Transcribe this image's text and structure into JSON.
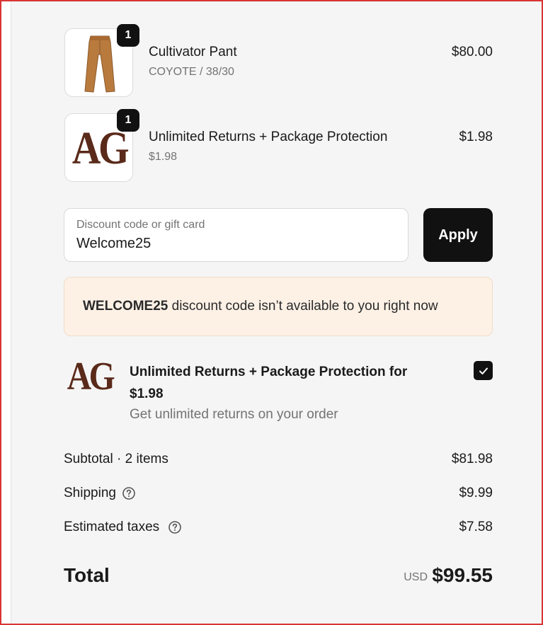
{
  "line_items": [
    {
      "quantity": "1",
      "name": "Cultivator Pant",
      "variant": "COYOTE / 38/30",
      "price": "$80.00",
      "image": "pants-image"
    },
    {
      "quantity": "1",
      "name": "Unlimited Returns + Package Protection",
      "variant": "$1.98",
      "price": "$1.98",
      "image": "ag-logo",
      "logo_text": "AG"
    }
  ],
  "discount": {
    "label": "Discount code or gift card",
    "value": "Welcome25",
    "apply_label": "Apply"
  },
  "notice": {
    "code": "WELCOME25",
    "message": " discount code isn’t available to you right now"
  },
  "protection_offer": {
    "logo_text": "AG",
    "title": "Unlimited Returns + Package Protection for $1.98",
    "description": "Get unlimited returns on your order",
    "checked": true
  },
  "summary": {
    "subtotal_label": "Subtotal · 2 items",
    "subtotal_value": "$81.98",
    "shipping_label": "Shipping",
    "shipping_value": "$9.99",
    "taxes_label": "Estimated taxes",
    "taxes_value": "$7.58",
    "total_label": "Total",
    "currency": "USD",
    "total_value": "$99.55"
  },
  "colors": {
    "brand_brown": "#5a2a1a",
    "button": "#111111",
    "notice_bg": "#fdf1e6",
    "frame": "#d93434"
  }
}
